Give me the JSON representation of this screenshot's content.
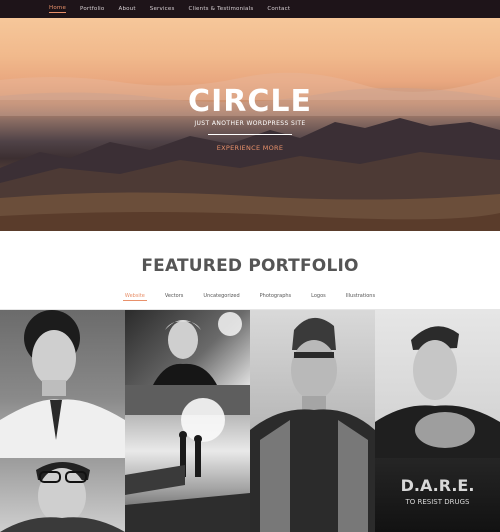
{
  "nav": {
    "items": [
      "Home",
      "Portfolio",
      "About",
      "Services",
      "Clients & Testimonials",
      "Contact"
    ],
    "active": "Home"
  },
  "hero": {
    "title": "CIRCLE",
    "subtitle": "JUST ANOTHER WORDPRESS SITE",
    "cta": "EXPERIENCE MORE"
  },
  "portfolio": {
    "title": "FEATURED PORTFOLIO",
    "filters": [
      "Website",
      "Vectors",
      "Uncategorized",
      "Photographs",
      "Logos",
      "Illustrations"
    ],
    "active_filter": "Website"
  },
  "tiles": [
    {
      "name": "tile-curly-hair-man"
    },
    {
      "name": "tile-woman-portrait"
    },
    {
      "name": "tile-beanie-man"
    },
    {
      "name": "tile-short-hair-man"
    },
    {
      "name": "tile-couple-silhouette"
    },
    {
      "name": "tile-glasses-man"
    },
    {
      "name": "tile-dare-shirt",
      "text_line1": "D.A.R.E.",
      "text_line2": "TO RESIST DRUGS"
    }
  ],
  "colors": {
    "accent": "#e8906a",
    "nav_bg": "#1e1419",
    "section_title": "#555555"
  }
}
